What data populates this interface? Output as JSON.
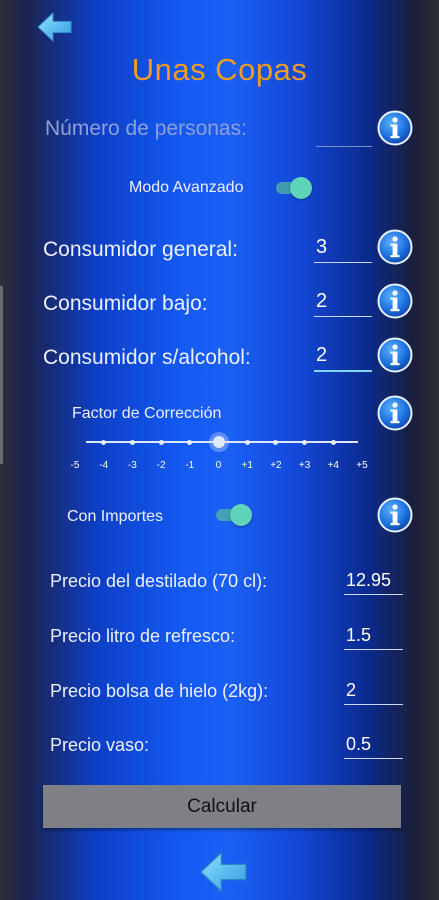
{
  "title": "Unas Copas",
  "personas": {
    "label": "Número de personas:",
    "value": ""
  },
  "modo_avanzado": {
    "label": "Modo Avanzado",
    "on": true
  },
  "consumidor_general": {
    "label": "Consumidor general:",
    "value": "3"
  },
  "consumidor_bajo": {
    "label": "Consumidor bajo:",
    "value": "2"
  },
  "consumidor_sin_alcohol": {
    "label": "Consumidor s/alcohol:",
    "value": "2"
  },
  "factor": {
    "label": "Factor de Corrección",
    "ticks": [
      "-5",
      "-4",
      "-3",
      "-2",
      "-1",
      "0",
      "+1",
      "+2",
      "+3",
      "+4",
      "+5"
    ],
    "selected": 0
  },
  "con_importes": {
    "label": "Con Importes",
    "on": true
  },
  "precio_destilado": {
    "label": "Precio del destilado (70 cl):",
    "value": "12.95"
  },
  "precio_refresco": {
    "label": "Precio litro de refresco:",
    "value": "1.5"
  },
  "precio_hielo": {
    "label": "Precio bolsa de hielo (2kg):",
    "value": "2"
  },
  "precio_vaso": {
    "label": "Precio vaso:",
    "value": "0.5"
  },
  "calcular_label": "Calcular",
  "colors": {
    "title": "#f39b1f",
    "toggle_on": "#5fd3ba",
    "info_blue": "#1f74e0"
  },
  "icons": [
    "back-arrow-icon",
    "info-icon"
  ]
}
